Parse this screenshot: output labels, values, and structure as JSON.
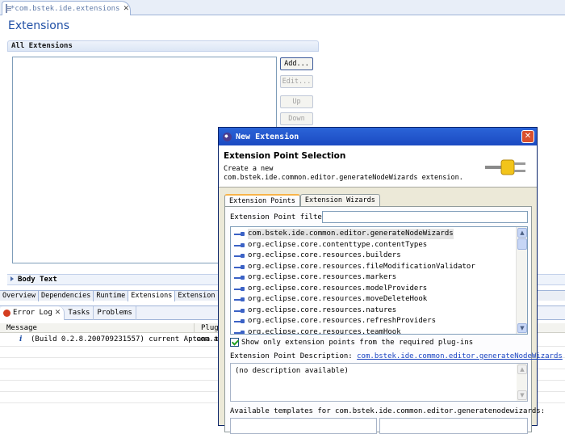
{
  "editor": {
    "tab_title": "*com.bstek.ide.extensions",
    "page_title": "Extensions",
    "all_extensions_header": "All Extensions",
    "buttons": {
      "add": "Add...",
      "edit": "Edit...",
      "up": "Up",
      "down": "Down"
    },
    "body_text_header": "Body Text",
    "page_tabs": [
      "Overview",
      "Dependencies",
      "Runtime",
      "Extensions",
      "Extension Poi"
    ]
  },
  "views": {
    "tabs": [
      "Error Log",
      "Tasks",
      "Problems"
    ],
    "columns": {
      "message": "Message",
      "plugin": "Plug-"
    },
    "rows": [
      {
        "message": "(Build 0.2.8.200709231557) current Aptana t",
        "plugin": "com.ap"
      }
    ]
  },
  "dialog": {
    "title": "New Extension",
    "section_title": "Extension Point Selection",
    "description": "Create a new com.bstek.ide.common.editor.generateNodeWizards extension.",
    "tabs": [
      "Extension Points",
      "Extension Wizards"
    ],
    "filter_label": "Extension Point filter:",
    "filter_value": "",
    "extension_points": [
      "com.bstek.ide.common.editor.generateNodeWizards",
      "org.eclipse.core.contenttype.contentTypes",
      "org.eclipse.core.resources.builders",
      "org.eclipse.core.resources.fileModificationValidator",
      "org.eclipse.core.resources.markers",
      "org.eclipse.core.resources.modelProviders",
      "org.eclipse.core.resources.moveDeleteHook",
      "org.eclipse.core.resources.natures",
      "org.eclipse.core.resources.refreshProviders",
      "org.eclipse.core.resources.teamHook"
    ],
    "show_only_label": "Show only extension points from the required plug-ins",
    "ep_description_label": "Extension Point Description:",
    "ep_description_link": "com.bstek.ide.common.editor.generateNodeWizards",
    "ep_description_text": "(no description available)",
    "templates_label": "Available templates for com.bstek.ide.common.editor.generatenodewizards:"
  },
  "colors": {
    "accent": "#1f4fa5",
    "titlebar": "#2b64d8",
    "close": "#d8502e"
  }
}
